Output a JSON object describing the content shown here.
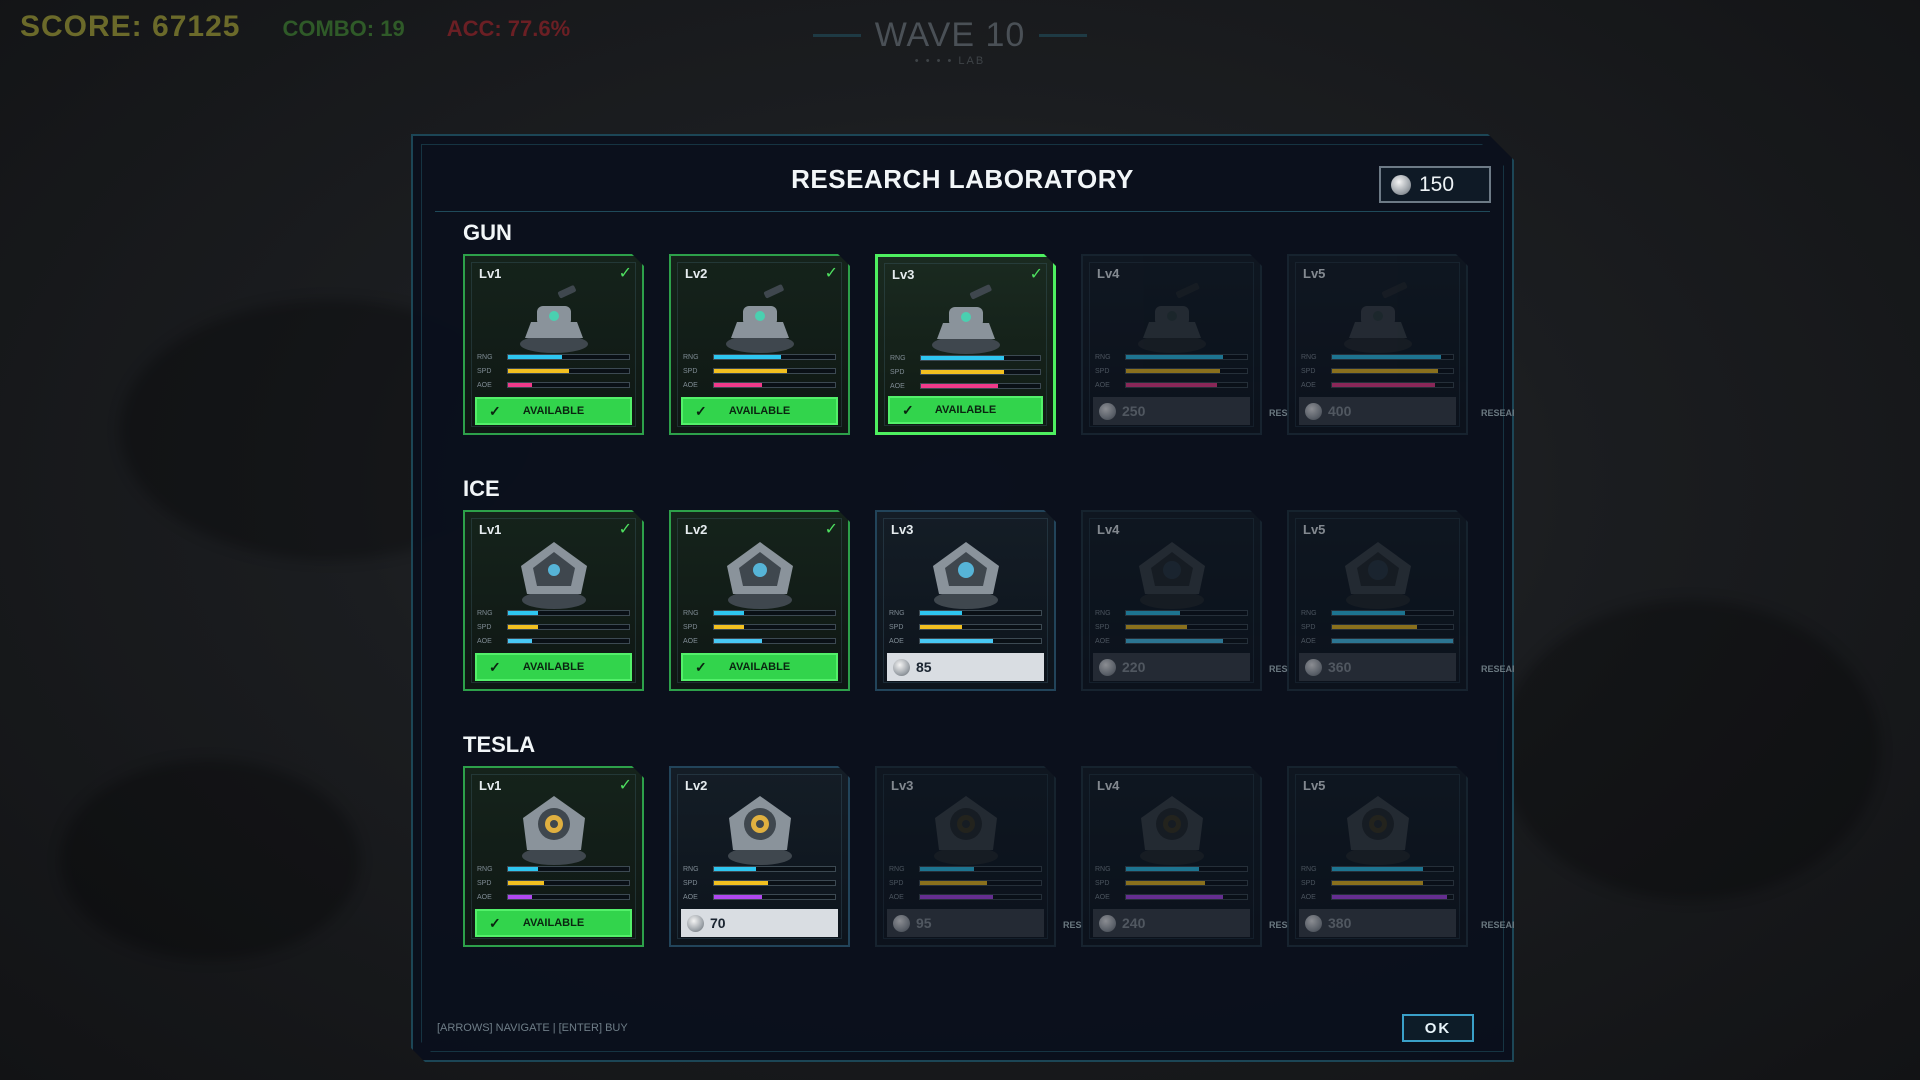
{
  "hud": {
    "score": "SCORE: 67125",
    "combo": "COMBO: 19",
    "acc": "ACC: 77.6%"
  },
  "wave": {
    "title": "WAVE 10",
    "sub": "• • • • LAB"
  },
  "panel": {
    "title": "RESEARCH LABORATORY",
    "currency": "150"
  },
  "labels": {
    "rng": "RNG",
    "spd": "SPD",
    "aoe": "AOE",
    "available": "AVAILABLE",
    "research": "RESEARCH",
    "res": "RES",
    "check": "✓"
  },
  "colors": {
    "rng": "#2ec6f0",
    "spd": "#f2c020",
    "gun_aoe": "#f03a8a",
    "ice_aoe": "#48c8f4",
    "tesla_aoe": "#b048f0",
    "owned": "#2da04a",
    "selected": "#4ef060"
  },
  "categories": [
    {
      "name": "GUN",
      "cards": [
        {
          "level": "Lv1",
          "state": "owned",
          "rng": 0.45,
          "spd": 0.5,
          "aoe": 0.2,
          "price": ""
        },
        {
          "level": "Lv2",
          "state": "owned",
          "rng": 0.55,
          "spd": 0.6,
          "aoe": 0.4,
          "price": ""
        },
        {
          "level": "Lv3",
          "state": "selected",
          "rng": 0.7,
          "spd": 0.7,
          "aoe": 0.65,
          "price": ""
        },
        {
          "level": "Lv4",
          "state": "locked",
          "rng": 0.8,
          "spd": 0.78,
          "aoe": 0.75,
          "price": "250"
        },
        {
          "level": "Lv5",
          "state": "locked",
          "rng": 0.9,
          "spd": 0.88,
          "aoe": 0.85,
          "price": "400"
        }
      ]
    },
    {
      "name": "ICE",
      "cards": [
        {
          "level": "Lv1",
          "state": "owned",
          "rng": 0.25,
          "spd": 0.25,
          "aoe": 0.2,
          "price": ""
        },
        {
          "level": "Lv2",
          "state": "owned",
          "rng": 0.25,
          "spd": 0.25,
          "aoe": 0.4,
          "price": ""
        },
        {
          "level": "Lv3",
          "state": "buyable",
          "rng": 0.35,
          "spd": 0.35,
          "aoe": 0.6,
          "price": "85"
        },
        {
          "level": "Lv4",
          "state": "locked",
          "rng": 0.45,
          "spd": 0.5,
          "aoe": 0.8,
          "price": "220"
        },
        {
          "level": "Lv5",
          "state": "locked",
          "rng": 0.6,
          "spd": 0.7,
          "aoe": 1.0,
          "price": "360"
        }
      ]
    },
    {
      "name": "TESLA",
      "cards": [
        {
          "level": "Lv1",
          "state": "owned",
          "rng": 0.25,
          "spd": 0.3,
          "aoe": 0.2,
          "price": ""
        },
        {
          "level": "Lv2",
          "state": "buyable",
          "rng": 0.35,
          "spd": 0.45,
          "aoe": 0.4,
          "price": "70"
        },
        {
          "level": "Lv3",
          "state": "locked",
          "rng": 0.45,
          "spd": 0.55,
          "aoe": 0.6,
          "price": "95"
        },
        {
          "level": "Lv4",
          "state": "locked",
          "rng": 0.6,
          "spd": 0.65,
          "aoe": 0.8,
          "price": "240"
        },
        {
          "level": "Lv5",
          "state": "locked",
          "rng": 0.75,
          "spd": 0.75,
          "aoe": 0.95,
          "price": "380"
        }
      ]
    }
  ],
  "footer": {
    "hint": "[ARROWS] NAVIGATE  |  [ENTER] BUY",
    "ok": "OK"
  }
}
